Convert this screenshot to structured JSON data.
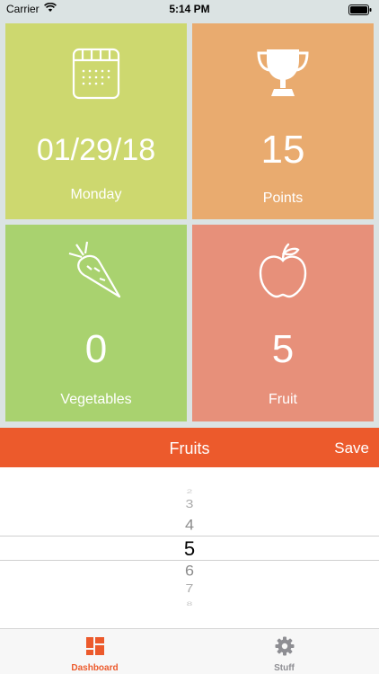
{
  "status_bar": {
    "carrier": "Carrier",
    "time": "5:14 PM"
  },
  "tiles": {
    "date": {
      "value": "01/29/18",
      "label": "Monday",
      "icon": "calendar-icon",
      "color": "#cdd86f"
    },
    "points": {
      "value": "15",
      "label": "Points",
      "icon": "trophy-icon",
      "color": "#e9ab6f"
    },
    "vegetables": {
      "value": "0",
      "label": "Vegetables",
      "icon": "carrot-icon",
      "color": "#a9d26f"
    },
    "fruit": {
      "value": "5",
      "label": "Fruit",
      "icon": "apple-icon",
      "color": "#e7907a"
    }
  },
  "picker_bar": {
    "title": "Fruits",
    "save_label": "Save",
    "color": "#ec5a2c"
  },
  "picker": {
    "values": [
      "2",
      "3",
      "4",
      "5",
      "6",
      "7",
      "8"
    ],
    "selected": "5"
  },
  "tabbar": {
    "active_color": "#ec5a2c",
    "inactive_color": "#8e8e93",
    "tabs": [
      {
        "label": "Dashboard",
        "icon": "dashboard-icon",
        "active": true
      },
      {
        "label": "Stuff",
        "icon": "gear-icon",
        "active": false
      }
    ]
  }
}
